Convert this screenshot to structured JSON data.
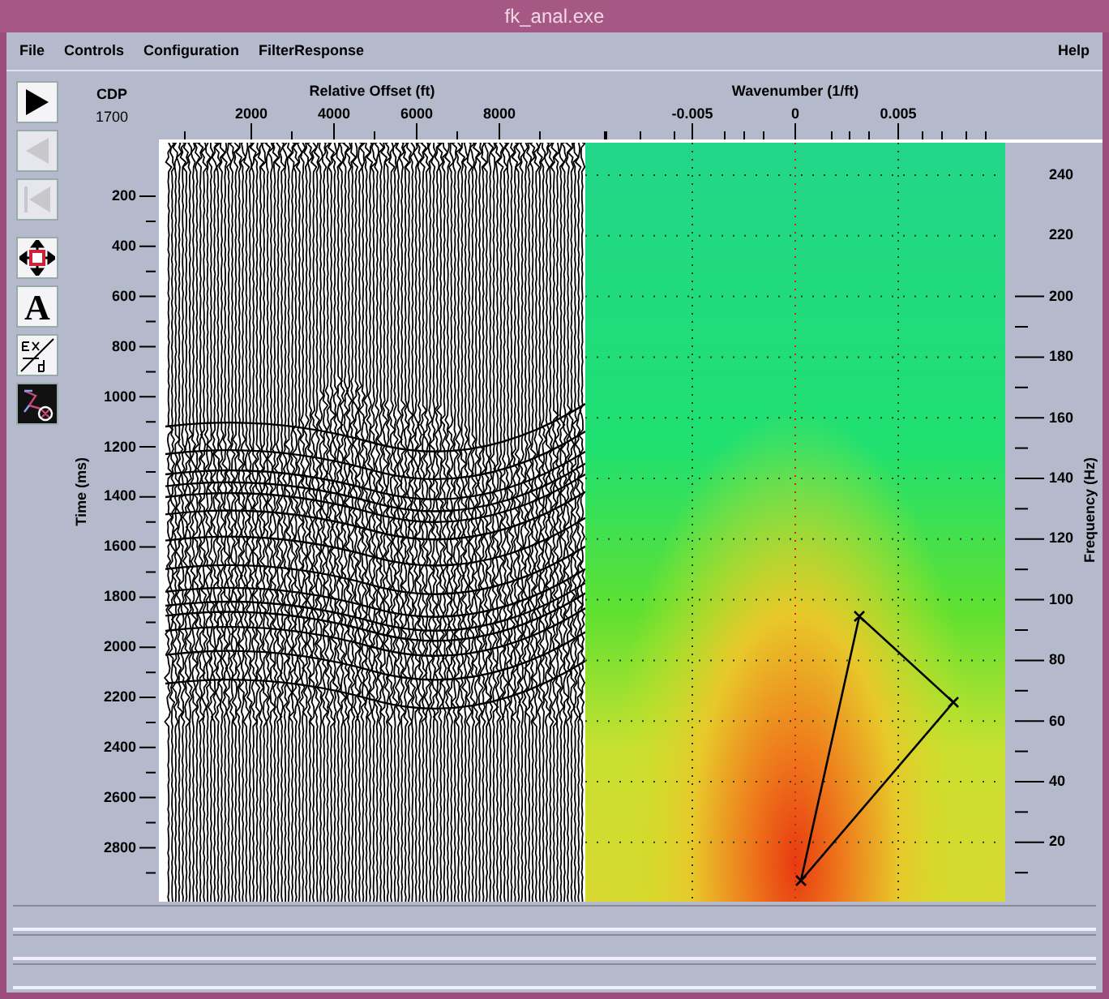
{
  "window": {
    "title": "fk_anal.exe"
  },
  "menu": {
    "items": [
      {
        "label": "File"
      },
      {
        "label": "Controls"
      },
      {
        "label": "Configuration"
      },
      {
        "label": "FilterResponse"
      }
    ],
    "help": {
      "label": "Help"
    }
  },
  "toolbar": [
    {
      "kind": "play",
      "disabled": false
    },
    {
      "kind": "back",
      "disabled": true
    },
    {
      "kind": "first",
      "disabled": true
    },
    {
      "kind": "move",
      "disabled": false
    },
    {
      "kind": "text",
      "glyph": "A",
      "disabled": false
    },
    {
      "kind": "formula",
      "disabled": false
    },
    {
      "kind": "network",
      "disabled": false
    }
  ],
  "cdp": {
    "label": "CDP",
    "value": "1700"
  },
  "offset_axis": {
    "title": "Relative Offset (ft)",
    "ticks": [
      "2000",
      "4000",
      "6000",
      "8000"
    ]
  },
  "wavenumber_axis": {
    "title": "Wavenumber (1/ft)",
    "ticks": [
      "-0.005",
      "0",
      "0.005"
    ]
  },
  "time_axis": {
    "title": "Time (ms)",
    "ticks": [
      "200",
      "400",
      "600",
      "800",
      "1000",
      "1200",
      "1400",
      "1600",
      "1800",
      "2000",
      "2200",
      "2400",
      "2600",
      "2800"
    ]
  },
  "frequency_axis": {
    "title": "Frequency (Hz)",
    "ticks": [
      "240",
      "220",
      "200",
      "180",
      "160",
      "140",
      "120",
      "100",
      "80",
      "60",
      "40",
      "20"
    ]
  }
}
